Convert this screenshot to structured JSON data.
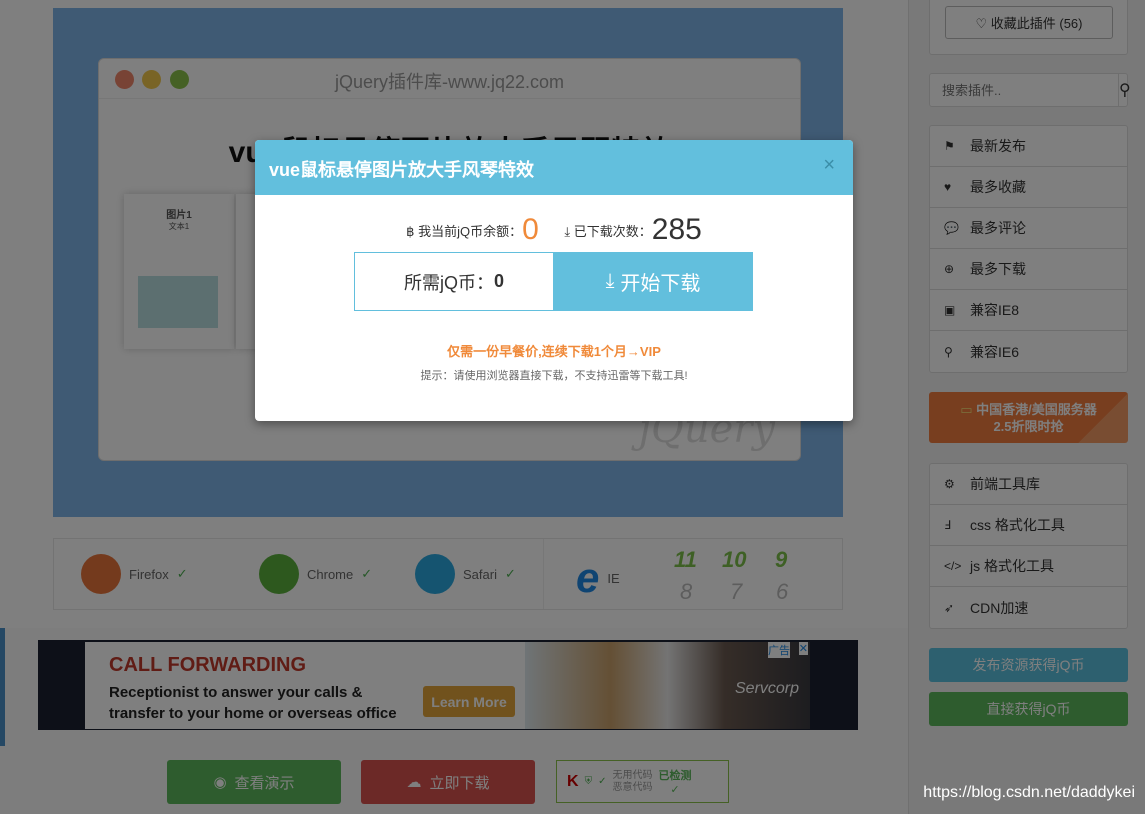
{
  "preview": {
    "window_title": "jQuery插件库-www.jq22.com",
    "heading": "vue鼠标悬停图片放大手风琴特效",
    "card_title": "图片1",
    "card_text": "文本1",
    "logo": "jQuery",
    "blue": "#7fb4e8"
  },
  "browsers": [
    {
      "name": "Firefox",
      "icon": "firefox-icon",
      "color": "#e8743b"
    },
    {
      "name": "Chrome",
      "icon": "chrome-icon",
      "color": "#5ab03c"
    },
    {
      "name": "Safari",
      "icon": "safari-icon",
      "color": "#2aa9e0"
    },
    {
      "name": "IE",
      "icon": "ie-icon",
      "color": "#1e88e5"
    }
  ],
  "ie_supported": [
    "11",
    "10",
    "9"
  ],
  "ie_unsupported": [
    "8",
    "7",
    "6"
  ],
  "check": "✓",
  "cross": "x",
  "ad": {
    "title": "CALL FORWARDING",
    "line1": "Receptionist to answer your calls &",
    "line2": "transfer to your home or overseas office",
    "cta": "Learn More",
    "badge": "广告",
    "brand": "Servcorp"
  },
  "bottom": {
    "demo": "查看演示",
    "download": "立即下载",
    "scan1": "无用代码",
    "scan2": "恶意代码",
    "scan_status": "已检测"
  },
  "sidebar": {
    "favorite": "♡ 收藏此插件 (56)",
    "search_placeholder": "搜索插件..",
    "nav": [
      {
        "label": "最新发布",
        "icon": "flag-icon",
        "g": "⚑"
      },
      {
        "label": "最多收藏",
        "icon": "heart-icon",
        "g": "♥"
      },
      {
        "label": "最多评论",
        "icon": "comments-icon",
        "g": "💬"
      },
      {
        "label": "最多下载",
        "icon": "download-circle-icon",
        "g": "⊕"
      },
      {
        "label": "兼容IE8",
        "icon": "bus-icon",
        "g": "▣"
      },
      {
        "label": "兼容IE6",
        "icon": "motorcycle-icon",
        "g": "⚲"
      }
    ],
    "promo_line1": "中国香港/美国服务器",
    "promo_line2": "2.5折限时抢",
    "tools": [
      {
        "label": "前端工具库",
        "icon": "gears-icon",
        "g": "⚙"
      },
      {
        "label": "css 格式化工具",
        "icon": "css3-icon",
        "g": "Ⅎ"
      },
      {
        "label": "js 格式化工具",
        "icon": "code-icon",
        "g": "</>"
      },
      {
        "label": "CDN加速",
        "icon": "rocket-icon",
        "g": "➶"
      }
    ],
    "publish": "发布资源获得jQ币",
    "get_coins": "直接获得jQ币"
  },
  "modal": {
    "title": "vue鼠标悬停图片放大手风琴特效",
    "close": "×",
    "balance_label": "我当前jQ币余额：",
    "balance": "0",
    "downloads_label": "已下载次数：",
    "downloads": "285",
    "need_label": "所需jQ币：",
    "need": "0",
    "download_button": "开始下载",
    "vip": "仅需一份早餐价,连续下载1个月→VIP",
    "hint": "提示：请使用浏览器直接下载，不支持迅雷等下载工具!",
    "accent": "#62bfdd",
    "orange": "#f08a3a"
  },
  "watermark": "https://blog.csdn.net/daddykei"
}
